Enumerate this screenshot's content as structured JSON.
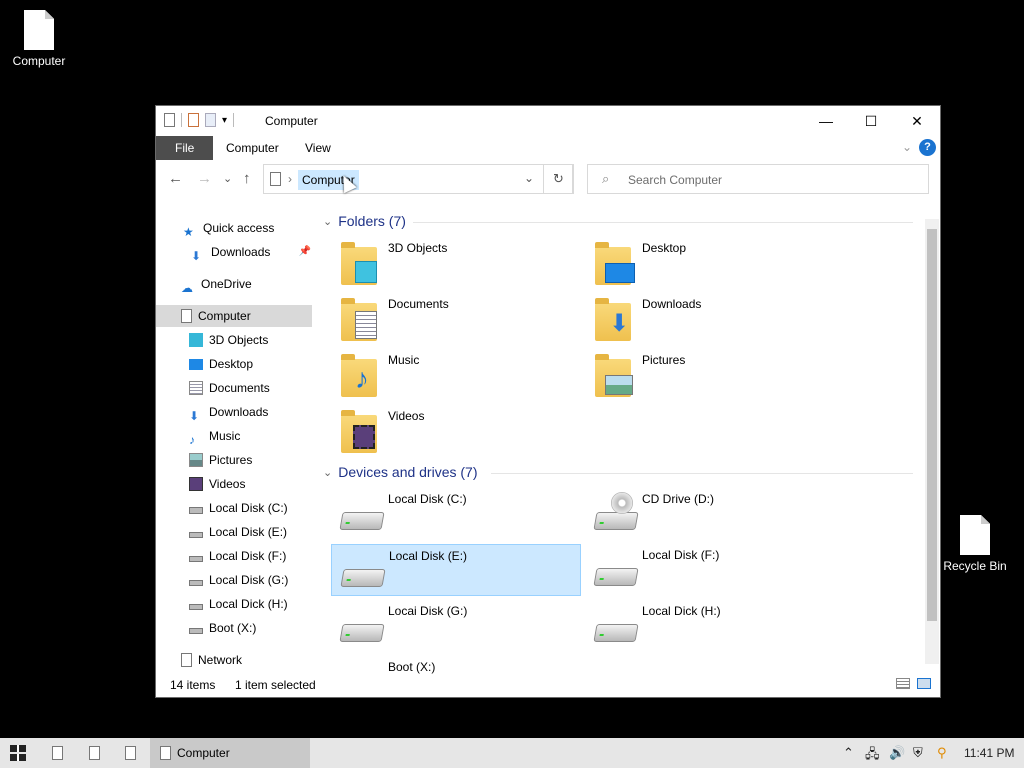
{
  "desktop": {
    "icons": [
      {
        "label": "Computer"
      },
      {
        "label": "Recycle Bin"
      }
    ]
  },
  "window": {
    "title": "Computer",
    "controls": {
      "minimize": "—",
      "maximize": "☐",
      "close": "✕"
    },
    "ribbon": {
      "tabs": [
        "File",
        "Computer",
        "View"
      ],
      "help": "?"
    },
    "address": {
      "crumb": "Computer"
    },
    "search": {
      "placeholder": "Search Computer"
    },
    "nav": {
      "items": [
        {
          "label": "Quick access",
          "icon": "star-icon"
        },
        {
          "label": "Downloads",
          "icon": "download-arrow-icon"
        },
        {
          "label": "OneDrive",
          "icon": "cloud-icon"
        },
        {
          "label": "Computer",
          "icon": "computer-icon",
          "selected": true
        },
        {
          "label": "3D Objects",
          "icon": "cube-icon"
        },
        {
          "label": "Desktop",
          "icon": "desktop-icon"
        },
        {
          "label": "Documents",
          "icon": "documents-icon"
        },
        {
          "label": "Downloads",
          "icon": "download-arrow-icon"
        },
        {
          "label": "Music",
          "icon": "music-note-icon"
        },
        {
          "label": "Pictures",
          "icon": "pictures-icon"
        },
        {
          "label": "Videos",
          "icon": "videos-icon"
        },
        {
          "label": "Local Disk (C:)",
          "icon": "system-disk-icon"
        },
        {
          "label": "Local Disk (E:)",
          "icon": "disk-icon"
        },
        {
          "label": "Local Disk (F:)",
          "icon": "disk-icon"
        },
        {
          "label": "Local Disk (G:)",
          "icon": "disk-icon"
        },
        {
          "label": "Local Dick (H:)",
          "icon": "disk-icon"
        },
        {
          "label": "Boot (X:)",
          "icon": "disk-icon"
        },
        {
          "label": "Network",
          "icon": "network-icon"
        }
      ]
    },
    "folders_group": {
      "heading": "Folders (7)",
      "items": [
        {
          "label": "3D Objects",
          "overlay": "cube"
        },
        {
          "label": "Desktop",
          "overlay": "desktop"
        },
        {
          "label": "Documents",
          "overlay": "doc"
        },
        {
          "label": "Downloads",
          "overlay": "down"
        },
        {
          "label": "Music",
          "overlay": "music"
        },
        {
          "label": "Pictures",
          "overlay": "pic"
        },
        {
          "label": "Videos",
          "overlay": "video"
        }
      ]
    },
    "drives_group": {
      "heading": "Devices and drives (7)",
      "items": [
        {
          "label": "Local Disk (C:)"
        },
        {
          "label": "CD Drive (D:)"
        },
        {
          "label": "Local Disk (E:)",
          "selected": true
        },
        {
          "label": "Local Disk (F:)"
        },
        {
          "label": "Locai Disk (G:)"
        },
        {
          "label": "Local Dick (H:)"
        },
        {
          "label": "Boot (X:)"
        }
      ]
    },
    "status": {
      "items": "14 items",
      "selection": "1 item selected"
    }
  },
  "taskbar": {
    "app_label": "Computer",
    "clock": "11:41 PM"
  },
  "colors": {
    "accent": "#1a73d0",
    "selection": "#cce8ff",
    "heading": "#1e3287"
  }
}
